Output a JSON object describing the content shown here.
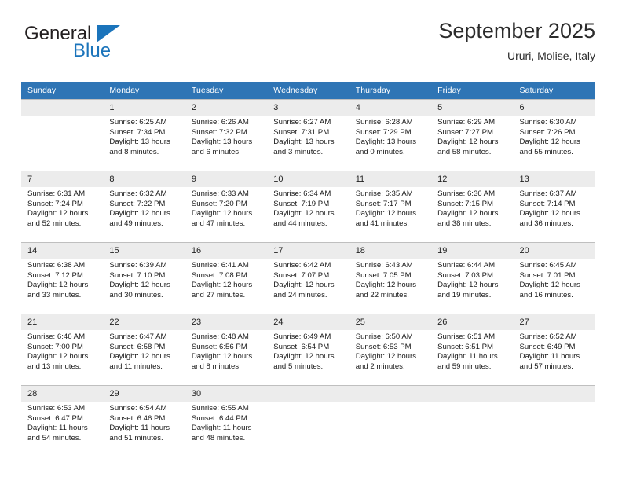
{
  "brand": {
    "name_top": "General",
    "name_bottom": "Blue",
    "triangle_color": "#1b74bb"
  },
  "header": {
    "month_title": "September 2025",
    "location": "Ururi, Molise, Italy"
  },
  "theme": {
    "header_blue": "#2f75b5",
    "daynum_band": "#ececec",
    "grid_line": "#bfbfbf",
    "text": "#1a1a1a"
  },
  "calendar": {
    "weekday_headers": [
      "Sunday",
      "Monday",
      "Tuesday",
      "Wednesday",
      "Thursday",
      "Friday",
      "Saturday"
    ],
    "labels": {
      "sunrise": "Sunrise:",
      "sunset": "Sunset:",
      "daylight": "Daylight:"
    },
    "weeks": [
      [
        {
          "day": "",
          "sunrise": "",
          "sunset": "",
          "daylight_line1": "",
          "daylight_line2": "",
          "empty": true
        },
        {
          "day": "1",
          "sunrise": "Sunrise: 6:25 AM",
          "sunset": "Sunset: 7:34 PM",
          "daylight_line1": "Daylight: 13 hours",
          "daylight_line2": "and 8 minutes."
        },
        {
          "day": "2",
          "sunrise": "Sunrise: 6:26 AM",
          "sunset": "Sunset: 7:32 PM",
          "daylight_line1": "Daylight: 13 hours",
          "daylight_line2": "and 6 minutes."
        },
        {
          "day": "3",
          "sunrise": "Sunrise: 6:27 AM",
          "sunset": "Sunset: 7:31 PM",
          "daylight_line1": "Daylight: 13 hours",
          "daylight_line2": "and 3 minutes."
        },
        {
          "day": "4",
          "sunrise": "Sunrise: 6:28 AM",
          "sunset": "Sunset: 7:29 PM",
          "daylight_line1": "Daylight: 13 hours",
          "daylight_line2": "and 0 minutes."
        },
        {
          "day": "5",
          "sunrise": "Sunrise: 6:29 AM",
          "sunset": "Sunset: 7:27 PM",
          "daylight_line1": "Daylight: 12 hours",
          "daylight_line2": "and 58 minutes."
        },
        {
          "day": "6",
          "sunrise": "Sunrise: 6:30 AM",
          "sunset": "Sunset: 7:26 PM",
          "daylight_line1": "Daylight: 12 hours",
          "daylight_line2": "and 55 minutes."
        }
      ],
      [
        {
          "day": "7",
          "sunrise": "Sunrise: 6:31 AM",
          "sunset": "Sunset: 7:24 PM",
          "daylight_line1": "Daylight: 12 hours",
          "daylight_line2": "and 52 minutes."
        },
        {
          "day": "8",
          "sunrise": "Sunrise: 6:32 AM",
          "sunset": "Sunset: 7:22 PM",
          "daylight_line1": "Daylight: 12 hours",
          "daylight_line2": "and 49 minutes."
        },
        {
          "day": "9",
          "sunrise": "Sunrise: 6:33 AM",
          "sunset": "Sunset: 7:20 PM",
          "daylight_line1": "Daylight: 12 hours",
          "daylight_line2": "and 47 minutes."
        },
        {
          "day": "10",
          "sunrise": "Sunrise: 6:34 AM",
          "sunset": "Sunset: 7:19 PM",
          "daylight_line1": "Daylight: 12 hours",
          "daylight_line2": "and 44 minutes."
        },
        {
          "day": "11",
          "sunrise": "Sunrise: 6:35 AM",
          "sunset": "Sunset: 7:17 PM",
          "daylight_line1": "Daylight: 12 hours",
          "daylight_line2": "and 41 minutes."
        },
        {
          "day": "12",
          "sunrise": "Sunrise: 6:36 AM",
          "sunset": "Sunset: 7:15 PM",
          "daylight_line1": "Daylight: 12 hours",
          "daylight_line2": "and 38 minutes."
        },
        {
          "day": "13",
          "sunrise": "Sunrise: 6:37 AM",
          "sunset": "Sunset: 7:14 PM",
          "daylight_line1": "Daylight: 12 hours",
          "daylight_line2": "and 36 minutes."
        }
      ],
      [
        {
          "day": "14",
          "sunrise": "Sunrise: 6:38 AM",
          "sunset": "Sunset: 7:12 PM",
          "daylight_line1": "Daylight: 12 hours",
          "daylight_line2": "and 33 minutes."
        },
        {
          "day": "15",
          "sunrise": "Sunrise: 6:39 AM",
          "sunset": "Sunset: 7:10 PM",
          "daylight_line1": "Daylight: 12 hours",
          "daylight_line2": "and 30 minutes."
        },
        {
          "day": "16",
          "sunrise": "Sunrise: 6:41 AM",
          "sunset": "Sunset: 7:08 PM",
          "daylight_line1": "Daylight: 12 hours",
          "daylight_line2": "and 27 minutes."
        },
        {
          "day": "17",
          "sunrise": "Sunrise: 6:42 AM",
          "sunset": "Sunset: 7:07 PM",
          "daylight_line1": "Daylight: 12 hours",
          "daylight_line2": "and 24 minutes."
        },
        {
          "day": "18",
          "sunrise": "Sunrise: 6:43 AM",
          "sunset": "Sunset: 7:05 PM",
          "daylight_line1": "Daylight: 12 hours",
          "daylight_line2": "and 22 minutes."
        },
        {
          "day": "19",
          "sunrise": "Sunrise: 6:44 AM",
          "sunset": "Sunset: 7:03 PM",
          "daylight_line1": "Daylight: 12 hours",
          "daylight_line2": "and 19 minutes."
        },
        {
          "day": "20",
          "sunrise": "Sunrise: 6:45 AM",
          "sunset": "Sunset: 7:01 PM",
          "daylight_line1": "Daylight: 12 hours",
          "daylight_line2": "and 16 minutes."
        }
      ],
      [
        {
          "day": "21",
          "sunrise": "Sunrise: 6:46 AM",
          "sunset": "Sunset: 7:00 PM",
          "daylight_line1": "Daylight: 12 hours",
          "daylight_line2": "and 13 minutes."
        },
        {
          "day": "22",
          "sunrise": "Sunrise: 6:47 AM",
          "sunset": "Sunset: 6:58 PM",
          "daylight_line1": "Daylight: 12 hours",
          "daylight_line2": "and 11 minutes."
        },
        {
          "day": "23",
          "sunrise": "Sunrise: 6:48 AM",
          "sunset": "Sunset: 6:56 PM",
          "daylight_line1": "Daylight: 12 hours",
          "daylight_line2": "and 8 minutes."
        },
        {
          "day": "24",
          "sunrise": "Sunrise: 6:49 AM",
          "sunset": "Sunset: 6:54 PM",
          "daylight_line1": "Daylight: 12 hours",
          "daylight_line2": "and 5 minutes."
        },
        {
          "day": "25",
          "sunrise": "Sunrise: 6:50 AM",
          "sunset": "Sunset: 6:53 PM",
          "daylight_line1": "Daylight: 12 hours",
          "daylight_line2": "and 2 minutes."
        },
        {
          "day": "26",
          "sunrise": "Sunrise: 6:51 AM",
          "sunset": "Sunset: 6:51 PM",
          "daylight_line1": "Daylight: 11 hours",
          "daylight_line2": "and 59 minutes."
        },
        {
          "day": "27",
          "sunrise": "Sunrise: 6:52 AM",
          "sunset": "Sunset: 6:49 PM",
          "daylight_line1": "Daylight: 11 hours",
          "daylight_line2": "and 57 minutes."
        }
      ],
      [
        {
          "day": "28",
          "sunrise": "Sunrise: 6:53 AM",
          "sunset": "Sunset: 6:47 PM",
          "daylight_line1": "Daylight: 11 hours",
          "daylight_line2": "and 54 minutes."
        },
        {
          "day": "29",
          "sunrise": "Sunrise: 6:54 AM",
          "sunset": "Sunset: 6:46 PM",
          "daylight_line1": "Daylight: 11 hours",
          "daylight_line2": "and 51 minutes."
        },
        {
          "day": "30",
          "sunrise": "Sunrise: 6:55 AM",
          "sunset": "Sunset: 6:44 PM",
          "daylight_line1": "Daylight: 11 hours",
          "daylight_line2": "and 48 minutes."
        },
        {
          "day": "",
          "sunrise": "",
          "sunset": "",
          "daylight_line1": "",
          "daylight_line2": "",
          "empty": true
        },
        {
          "day": "",
          "sunrise": "",
          "sunset": "",
          "daylight_line1": "",
          "daylight_line2": "",
          "empty": true
        },
        {
          "day": "",
          "sunrise": "",
          "sunset": "",
          "daylight_line1": "",
          "daylight_line2": "",
          "empty": true
        },
        {
          "day": "",
          "sunrise": "",
          "sunset": "",
          "daylight_line1": "",
          "daylight_line2": "",
          "empty": true
        }
      ]
    ]
  }
}
